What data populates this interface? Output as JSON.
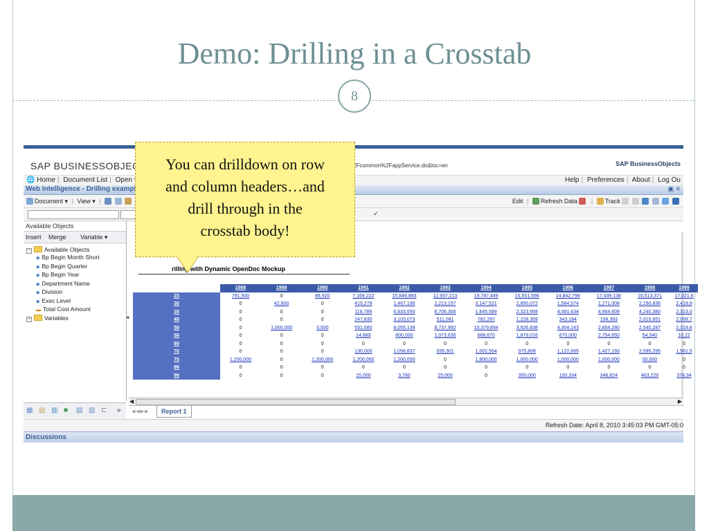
{
  "slide": {
    "title": "Demo:  Drilling in a Crosstab",
    "number": "8"
  },
  "callout": {
    "lines": [
      "You can drilldown on row",
      "and column headers…and",
      "drill through in the",
      "crosstab body!"
    ]
  },
  "app": {
    "brand": "SAP BUSINESSOBJECTS",
    "logo": "SAP BusinessObjects",
    "url_fragment": "2Fcommon%2FappService.do&loc=en",
    "nav_left": [
      "Home",
      "Document List",
      "Open ▾"
    ],
    "nav_right": [
      "Help",
      "Preferences",
      "About",
      "Log Ou"
    ],
    "window_title": "Web Intelligence - Drilling example",
    "window_controls": "▣ ✕",
    "toolbar": {
      "document": "Document ▾",
      "view": "View ▾",
      "edit": "Edit",
      "refresh": "Refresh Data",
      "track": "Track"
    },
    "panel": {
      "title": "Available Objects",
      "insert": "Insert",
      "merge": "Merge",
      "variable": "Variable ▾",
      "root": "Available Objects",
      "items": [
        {
          "label": "Bp Begin Month Short",
          "kind": "dim"
        },
        {
          "label": "Bp Begin Quarter",
          "kind": "dim"
        },
        {
          "label": "Bp Begin Year",
          "kind": "dim"
        },
        {
          "label": "Department Name",
          "kind": "dim"
        },
        {
          "label": "Division",
          "kind": "dim"
        },
        {
          "label": "Exec Level",
          "kind": "dim"
        },
        {
          "label": "Total Cost Amount",
          "kind": "measure"
        }
      ],
      "variables": "Variables"
    },
    "report_tab": "Report 1",
    "status": "Refresh Date:  April 8, 2010 3:45:03 PM GMT-05:0",
    "discussions": "Discussions",
    "crosstab_title": "rilling with Dynamic OpenDoc Mockup"
  },
  "crosstab": {
    "columns": [
      "1988",
      "1989",
      "1990",
      "1991",
      "1992",
      "1993",
      "1994",
      "1995",
      "1996",
      "1997",
      "1998",
      "1999"
    ],
    "rows": [
      {
        "head": "23",
        "cells": [
          "791,500",
          "0",
          "86,920",
          "7,169,222",
          "15,849,883",
          "11,937,213",
          "19,787,449",
          "15,551,596",
          "14,842,796",
          "17,439,138",
          "16,513,371",
          "17,021,6"
        ]
      },
      {
        "head": "30",
        "cells": [
          "0",
          "42,500",
          "0",
          "415,279",
          "1,467,195",
          "2,213,157",
          "3,147,521",
          "2,850,072",
          "1,584,574",
          "1,271,008",
          "2,150,836",
          "2,419,9"
        ]
      },
      {
        "head": "35",
        "cells": [
          "0",
          "0",
          "0",
          "118,789",
          "6,833,550",
          "6,706,300",
          "1,645,589",
          "2,323,959",
          "4,081,634",
          "4,664,609",
          "4,240,380",
          "2,313,0"
        ]
      },
      {
        "head": "45",
        "cells": [
          "0",
          "0",
          "0",
          "247,830",
          "3,103,073",
          "511,081",
          "782,297",
          "1,228,359",
          "343,184",
          "158,393",
          "2,015,651",
          "2,059,7"
        ]
      },
      {
        "head": "50",
        "cells": [
          "0",
          "1,000,000",
          "3,500",
          "551,580",
          "8,055,139",
          "8,737,992",
          "10,379,894",
          "3,926,838",
          "4,304,143",
          "2,854,280",
          "2,540,287",
          "2,319,8"
        ]
      },
      {
        "head": "58",
        "cells": [
          "0",
          "0",
          "0",
          "14,889",
          "600,000",
          "1,073,630",
          "668,670",
          "1,879,016",
          "670,000",
          "2,754,650",
          "54,340",
          "10,22"
        ]
      },
      {
        "head": "60",
        "cells": [
          "0",
          "0",
          "0",
          "0",
          "0",
          "0",
          "0",
          "0",
          "0",
          "0",
          "0",
          "0"
        ]
      },
      {
        "head": "70",
        "cells": [
          "0",
          "0",
          "0",
          "130,000",
          "1,056,837",
          "939,301",
          "1,002,554",
          "975,806",
          "1,122,665",
          "1,427,193",
          "2,095,295",
          "1,561,5"
        ]
      },
      {
        "head": "75",
        "cells": [
          "1,200,000",
          "0",
          "1,200,000",
          "1,200,000",
          "1,200,000",
          "0",
          "1,800,000",
          "1,000,000",
          "1,000,000",
          "1,000,000",
          "50,000",
          "0"
        ]
      },
      {
        "head": "86",
        "cells": [
          "0",
          "0",
          "0",
          "0",
          "0",
          "0",
          "0",
          "0",
          "0",
          "0",
          "0",
          "0"
        ]
      },
      {
        "head": "99",
        "cells": [
          "0",
          "0",
          "0",
          "15,000",
          "3,780",
          "25,000",
          "0",
          "350,000",
          "100,334",
          "346,824",
          "463,229",
          "378,34"
        ]
      }
    ]
  }
}
